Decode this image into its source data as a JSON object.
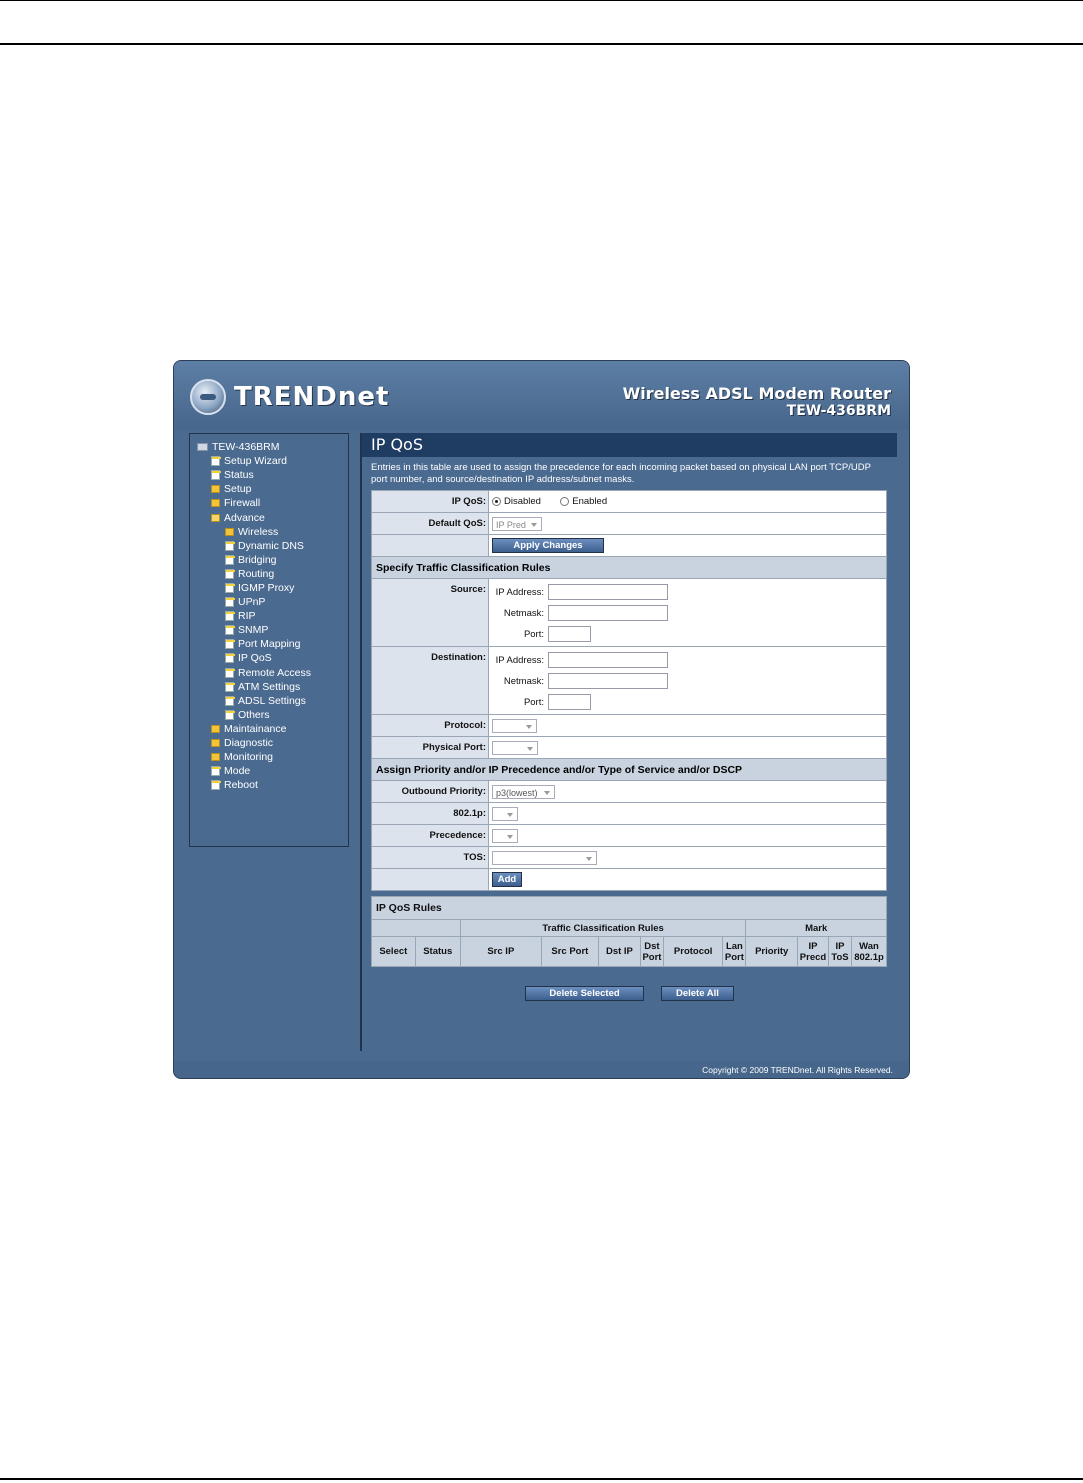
{
  "header": {
    "brand": "TRENDnet",
    "product_line": "Wireless ADSL Modem Router",
    "model": "TEW-436BRM"
  },
  "sidebar": {
    "root": "TEW-436BRM",
    "items": [
      {
        "label": "Setup Wizard",
        "icon": "doc-icon"
      },
      {
        "label": "Status",
        "icon": "doc-icon"
      },
      {
        "label": "Setup",
        "icon": "folder-icon"
      },
      {
        "label": "Firewall",
        "icon": "folder-icon"
      },
      {
        "label": "Advance",
        "icon": "folder-open-icon"
      }
    ],
    "advance_children": [
      "Wireless",
      "Dynamic DNS",
      "Bridging",
      "Routing",
      "IGMP Proxy",
      "UPnP",
      "RIP",
      "SNMP",
      "Port Mapping",
      "IP QoS",
      "Remote Access",
      "ATM Settings",
      "ADSL Settings",
      "Others"
    ],
    "bottom_items": [
      "Maintainance",
      "Diagnostic",
      "Monitoring",
      "Mode",
      "Reboot"
    ]
  },
  "main": {
    "title": "IP QoS",
    "description": "Entries in this table are used to assign the precedence for each incoming packet based on physical LAN port TCP/UDP port number, and source/destination IP address/subnet masks.",
    "ipqos_label": "IP QoS:",
    "disabled_label": "Disabled",
    "enabled_label": "Enabled",
    "default_qos_label": "Default QoS:",
    "default_qos_value": "IP Pred",
    "apply_button": "Apply Changes",
    "section_traffic": "Specify Traffic Classification Rules",
    "source_label": "Source:",
    "destination_label": "Destination:",
    "ip_address_label": "IP Address:",
    "netmask_label": "Netmask:",
    "port_label": "Port:",
    "protocol_label": "Protocol:",
    "physical_port_label": "Physical Port:",
    "section_priority": "Assign Priority and/or IP Precedence and/or Type of Service and/or DSCP",
    "outbound_priority_label": "Outbound Priority:",
    "outbound_priority_value": "p3(lowest)",
    "dot1p_label": "802.1p:",
    "precedence_label": "Precedence:",
    "tos_label": "TOS:",
    "add_button": "Add",
    "rules_title": "IP QoS Rules",
    "rules_group1": "Traffic Classification Rules",
    "rules_group2": "Mark",
    "rules_columns": [
      "Select",
      "Status",
      "Src IP",
      "Src Port",
      "Dst IP",
      "Dst Port",
      "Protocol",
      "Lan Port",
      "Priority",
      "IP Precd",
      "IP ToS",
      "Wan 802.1p"
    ],
    "delete_selected_button": "Delete Selected",
    "delete_all_button": "Delete All"
  },
  "footer": {
    "copyright": "Copyright © 2009 TRENDnet. All Rights Reserved."
  },
  "colors": {
    "panel": "#4b6a8f",
    "title_bar": "#1f3c63",
    "section": "#c9d3e0",
    "label_cell": "#dde3ec"
  }
}
